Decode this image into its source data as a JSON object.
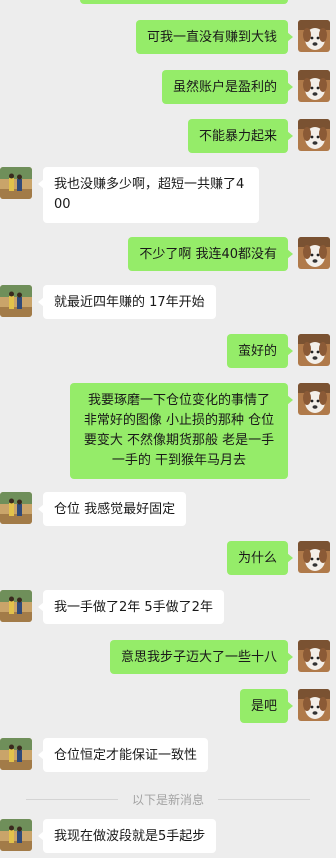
{
  "messages": [
    {
      "side": "me",
      "text": "可我一直没有赚到大钱"
    },
    {
      "side": "me",
      "text": "虽然账户是盈利的"
    },
    {
      "side": "me",
      "text": "不能暴力起来"
    },
    {
      "side": "other",
      "text": "我也没赚多少啊，超短一共赚了400"
    },
    {
      "side": "me",
      "text": "不少了啊 我连40都没有"
    },
    {
      "side": "other",
      "text": "就最近四年赚的  17年开始"
    },
    {
      "side": "me",
      "text": "蛮好的"
    },
    {
      "side": "me",
      "text": "我要琢磨一下仓位变化的事情了 非常好的图像 小止损的那种 仓位要变大  不然像期货那般 老是一手一手的 干到猴年马月去"
    },
    {
      "side": "other",
      "text": "仓位  我感觉最好固定"
    },
    {
      "side": "me",
      "text": "为什么"
    },
    {
      "side": "other",
      "text": "我一手做了2年  5手做了2年"
    },
    {
      "side": "me",
      "text": "意思我步子迈大了一些十八"
    },
    {
      "side": "me",
      "text": "是吧"
    },
    {
      "side": "other",
      "text": "仓位恒定才能保证一致性"
    },
    {
      "side": "other",
      "text": "我现在做波段就是5手起步"
    }
  ],
  "divider": {
    "label": "以下是新消息"
  },
  "icons": {
    "me_avatar": "dog-avatar-icon",
    "other_avatar": "people-avatar-icon"
  },
  "colors": {
    "me_bubble": "#95ec69",
    "other_bubble": "#ffffff",
    "background": "#ededed"
  }
}
